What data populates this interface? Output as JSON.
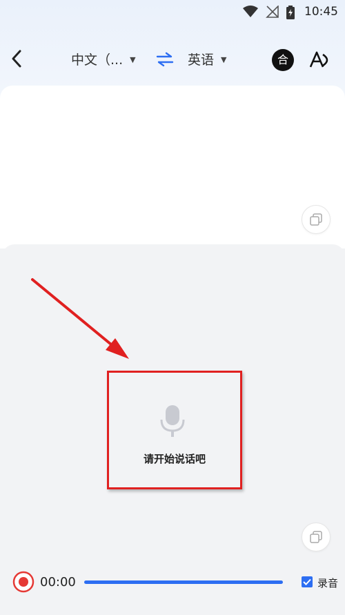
{
  "status_bar": {
    "time": "10:45"
  },
  "header": {
    "source_language": "中文（...",
    "target_language": "英语",
    "merge_button_label": "合"
  },
  "listening": {
    "prompt": "请开始说话吧"
  },
  "recorder": {
    "time": "00:00",
    "record_checkbox_label": "录音",
    "record_checked": true
  },
  "colors": {
    "accent": "#2d6ef2",
    "record_red": "#e53935",
    "annotation_red": "#e02020"
  }
}
